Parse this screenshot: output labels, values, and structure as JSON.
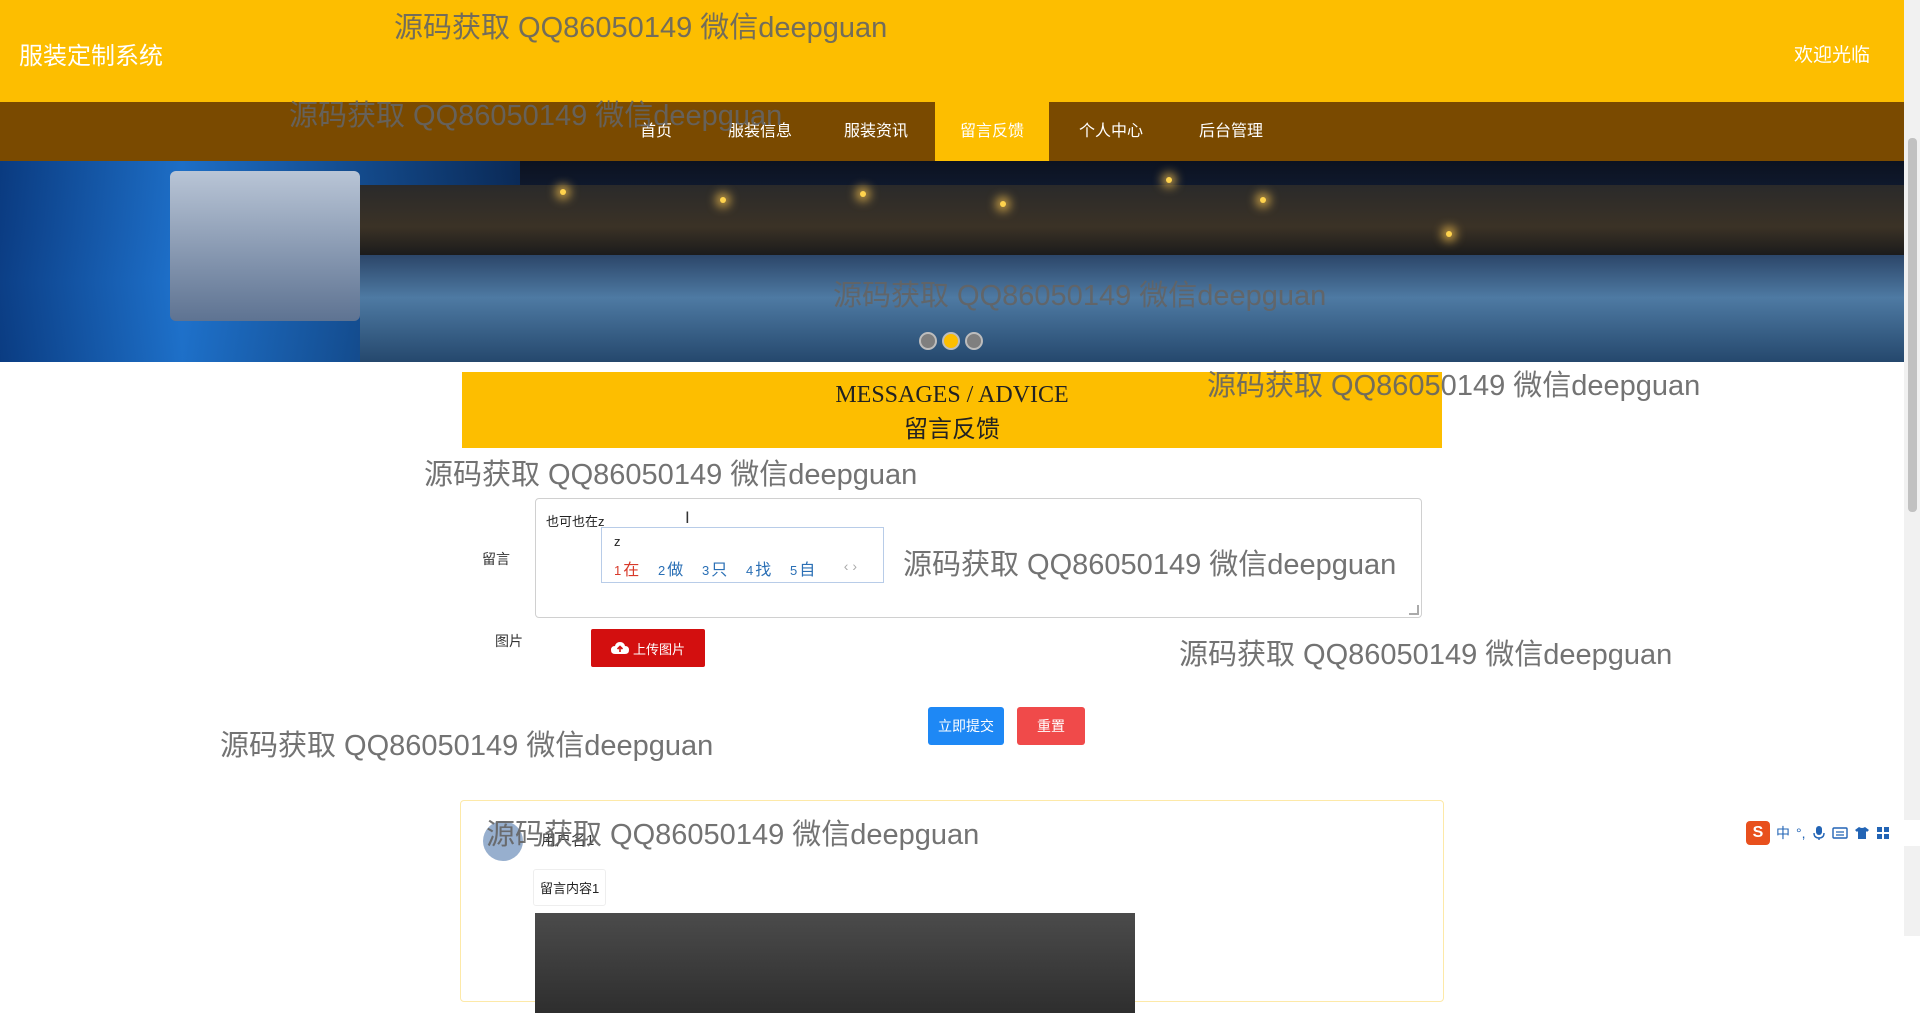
{
  "header": {
    "brand": "服装定制系统",
    "welcome": "欢迎光临"
  },
  "nav": {
    "items": [
      {
        "label": "首页"
      },
      {
        "label": "服装信息"
      },
      {
        "label": "服装资讯"
      },
      {
        "label": "留言反馈"
      },
      {
        "label": "个人中心"
      },
      {
        "label": "后台管理"
      }
    ],
    "active_index": 3
  },
  "carousel": {
    "slide_count": 3,
    "active_slide": 2
  },
  "section": {
    "title_en": "MESSAGES / ADVICE",
    "title_cn": "留言反馈"
  },
  "form": {
    "message_label": "留言",
    "message_value": "也可也在z",
    "image_label": "图片",
    "upload_label": "上传图片",
    "submit_label": "立即提交",
    "reset_label": "重置"
  },
  "ime_popup": {
    "pinyin": "z",
    "candidates": [
      {
        "num": "1",
        "text": "在"
      },
      {
        "num": "2",
        "text": "做"
      },
      {
        "num": "3",
        "text": "只"
      },
      {
        "num": "4",
        "text": "找"
      },
      {
        "num": "5",
        "text": "自"
      }
    ],
    "arrows": "‹ ›"
  },
  "message_card": {
    "user": "用户名1",
    "content": "留言内容1"
  },
  "watermark_text": "源码获取 QQ86050149 微信deepguan",
  "ime_toolbar": {
    "logo": "S",
    "mode": "中",
    "punct": "°,"
  },
  "colors": {
    "primary_yellow": "#fdbe00",
    "nav_brown": "#7a4a00",
    "upload_red": "#d30f0f",
    "submit_blue": "#1e88f5",
    "reset_red": "#f04a4a"
  }
}
